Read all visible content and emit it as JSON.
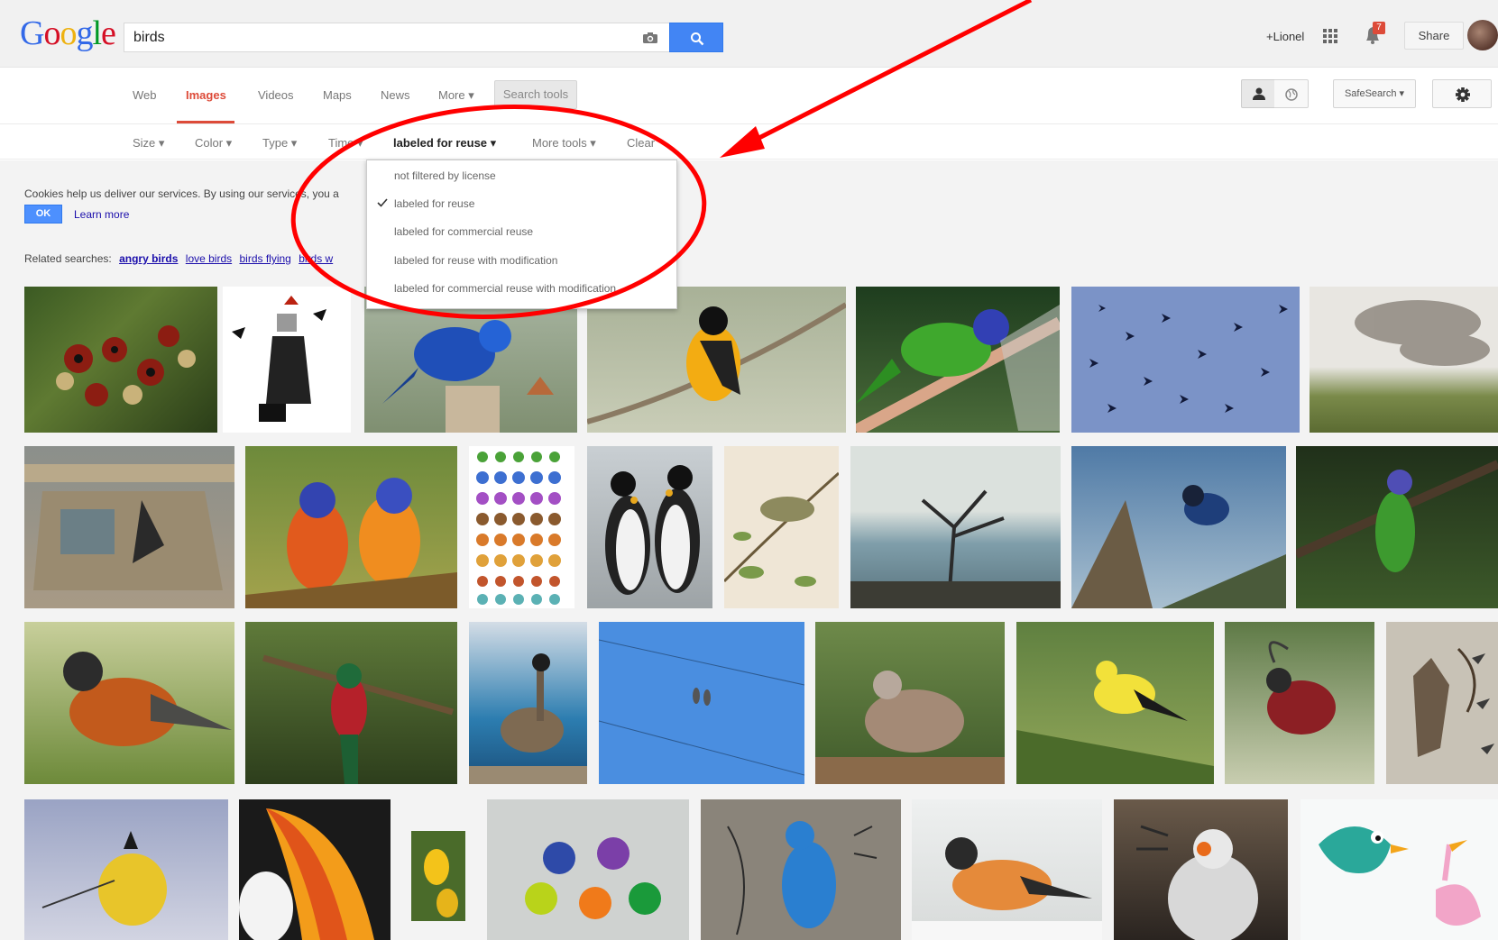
{
  "search": {
    "query": "birds"
  },
  "header": {
    "user_label": "+Lionel",
    "notifications_count": "7",
    "share_label": "Share"
  },
  "tabs": [
    {
      "label": "Web"
    },
    {
      "label": "Images"
    },
    {
      "label": "Videos"
    },
    {
      "label": "Maps"
    },
    {
      "label": "News"
    },
    {
      "label": "More ▾"
    }
  ],
  "search_tools_label": "Search tools",
  "safesearch_label": "SafeSearch ▾",
  "tools": [
    {
      "label": "Size ▾"
    },
    {
      "label": "Color ▾"
    },
    {
      "label": "Type ▾"
    },
    {
      "label": "Time ▾"
    },
    {
      "label": "labeled for reuse ▾"
    },
    {
      "label": "More tools ▾"
    },
    {
      "label": "Clear"
    }
  ],
  "license_menu": {
    "items": [
      {
        "label": "not filtered by license",
        "checked": false
      },
      {
        "label": "labeled for reuse",
        "checked": true
      },
      {
        "label": "labeled for commercial reuse",
        "checked": false
      },
      {
        "label": "labeled for reuse with modification",
        "checked": false
      },
      {
        "label": "labeled for commercial reuse with modification",
        "checked": false
      }
    ]
  },
  "cookies": {
    "text": "Cookies help us deliver our services. By using our services, you a",
    "ok_label": "OK",
    "learn_more_label": "Learn more"
  },
  "related": {
    "label": "Related searches:",
    "links": [
      {
        "label": "angry birds",
        "bold": true
      },
      {
        "label": "love birds",
        "bold": false
      },
      {
        "label": "birds flying",
        "bold": false
      },
      {
        "label": "birds w",
        "bold": false
      }
    ]
  },
  "colors": {
    "accent_red": "#dd4b39",
    "link_blue": "#1a0dab",
    "button_blue": "#4285f4",
    "annotation_red": "#ff0000"
  }
}
